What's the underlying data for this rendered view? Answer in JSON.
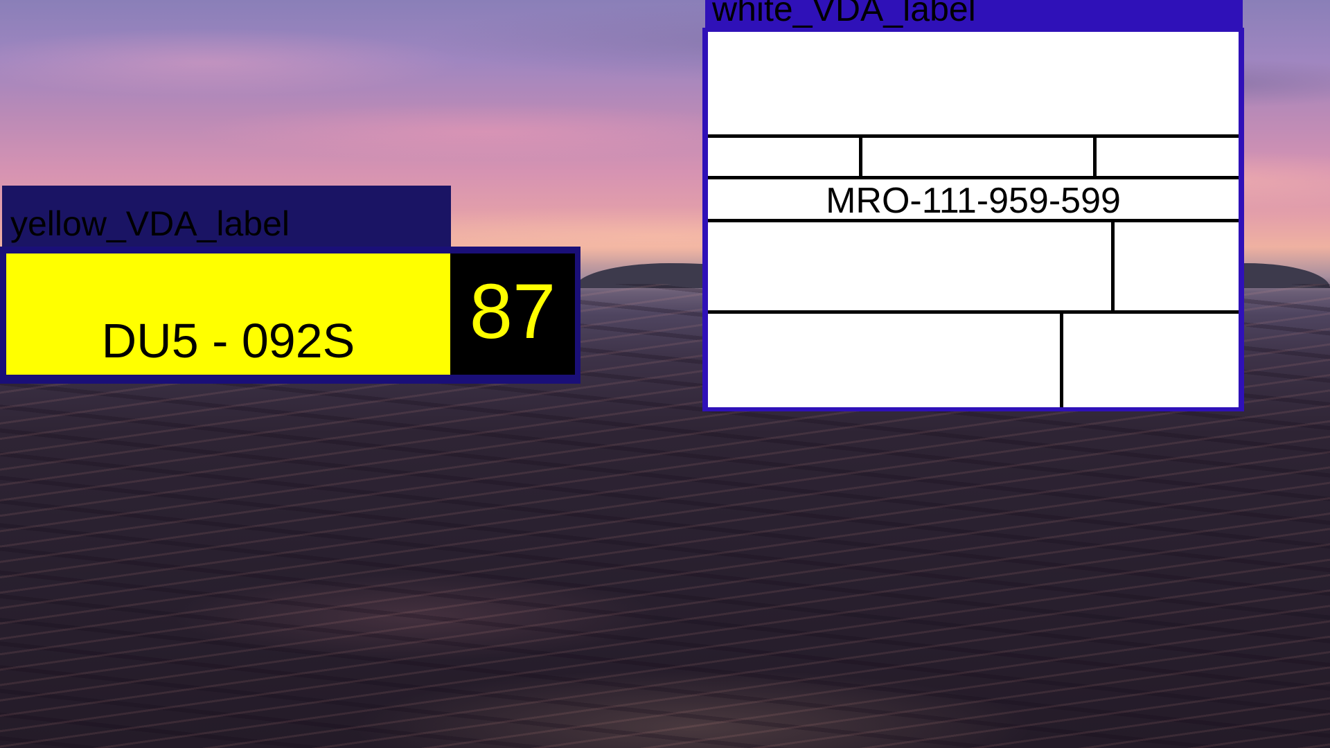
{
  "background": {
    "description_colors": {
      "sky_top": "#8a7fb8",
      "sky_glow": "#efb1a1",
      "sea": "#2a2130"
    }
  },
  "yellow_label": {
    "header": "yellow_VDA_label",
    "code": "DU5 - 092S",
    "number": "87",
    "colors": {
      "header_bg": "#1a1464",
      "frame": "#1a0f78",
      "field": "#ffff00",
      "number_box": "#000000",
      "number_text": "#ffff00"
    }
  },
  "white_label": {
    "header": "white_VDA_label",
    "code": "MRO-111-959-599",
    "colors": {
      "frame": "#2f11b8",
      "field": "#ffffff",
      "lines": "#000000"
    }
  }
}
